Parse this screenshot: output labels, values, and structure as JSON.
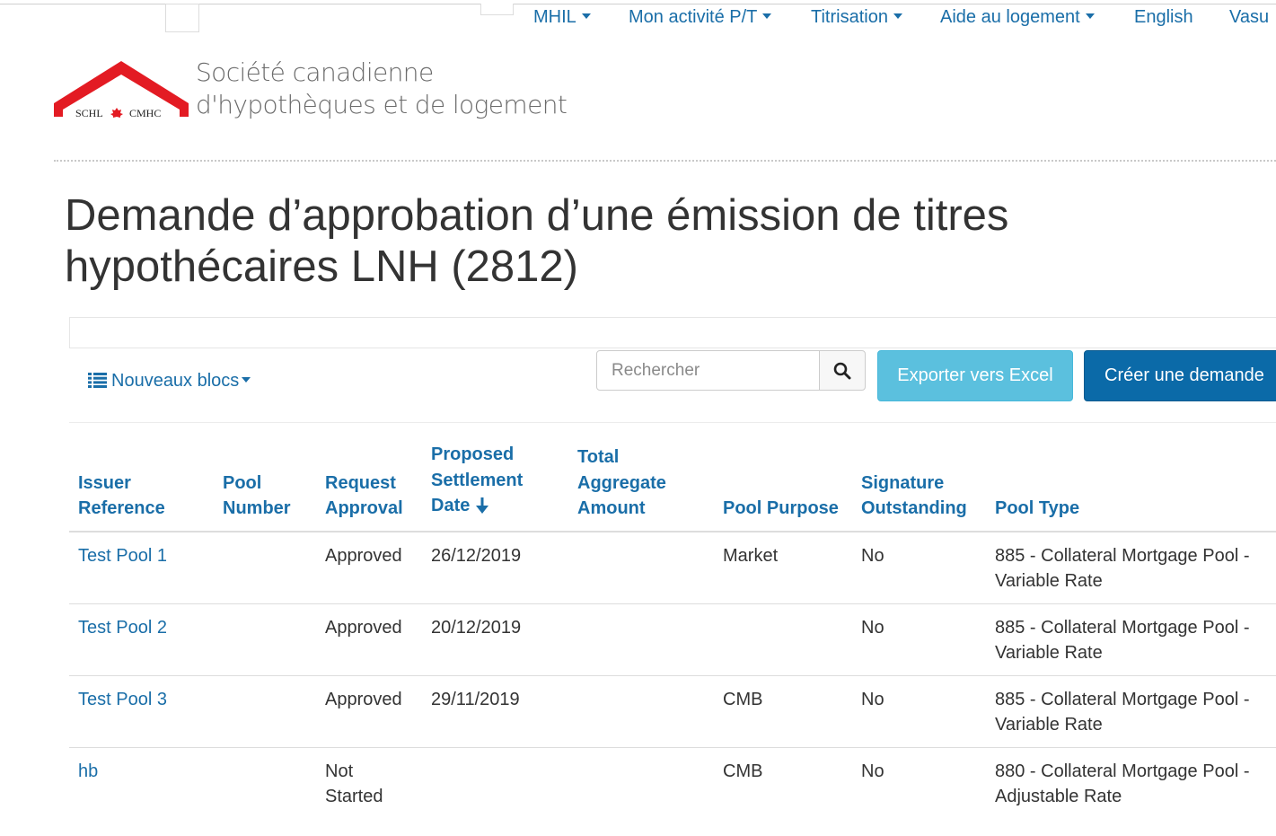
{
  "nav": {
    "items": [
      {
        "label": "MHIL",
        "has_caret": true
      },
      {
        "label": "Mon activité P/T",
        "has_caret": true
      },
      {
        "label": "Titrisation",
        "has_caret": true
      },
      {
        "label": "Aide au logement",
        "has_caret": true
      },
      {
        "label": "English",
        "has_caret": false
      },
      {
        "label": "Vasu",
        "has_caret": false
      }
    ]
  },
  "brand": {
    "logo_text": "SCHL CMHC",
    "org_line1": "Société canadienne",
    "org_line2": "d'hypothèques et de logement",
    "logo_color": "#e31b23"
  },
  "page": {
    "title": "Demande d’approbation d’une émission de titres hypothécaires LNH (2812)"
  },
  "toolbar": {
    "blocks_label": "Nouveaux blocs",
    "search_placeholder": "Rechercher",
    "export_label": "Exporter vers Excel",
    "create_label": "Créer une demande"
  },
  "table": {
    "headers": [
      "Issuer Reference",
      "Pool Number",
      "Request Approval",
      "Proposed Settlement Date",
      "Total Aggregate Amount",
      "Pool Purpose",
      "Signature Outstanding",
      "Pool Type"
    ],
    "sorted_column": "Proposed Settlement Date",
    "sort_direction": "descending",
    "rows": [
      [
        "Test Pool 1",
        "",
        "Approved",
        "26/12/2019",
        "",
        "Market",
        "No",
        "885 - Collateral Mortgage Pool - Variable Rate"
      ],
      [
        "Test Pool 2",
        "",
        "Approved",
        "20/12/2019",
        "",
        "",
        "No",
        "885 - Collateral Mortgage Pool - Variable Rate"
      ],
      [
        "Test Pool 3",
        "",
        "Approved",
        "29/11/2019",
        "",
        "CMB",
        "No",
        "885 - Collateral Mortgage Pool - Variable Rate"
      ],
      [
        "hb",
        "",
        "Not Started",
        "",
        "",
        "CMB",
        "No",
        "880 - Collateral Mortgage Pool - Adjustable Rate"
      ]
    ]
  },
  "colors": {
    "link": "#1a6ea8",
    "export_button": "#5bc0de",
    "create_button": "#0b6aa8"
  }
}
